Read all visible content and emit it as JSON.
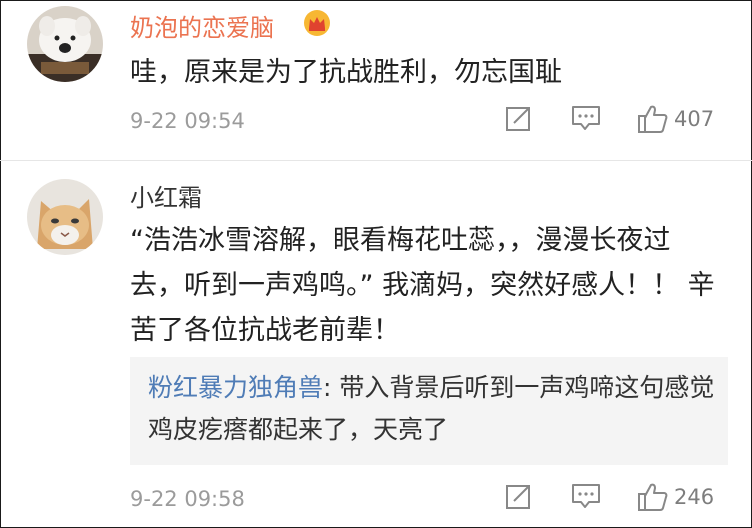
{
  "comments": [
    {
      "username": "奶泡的恋爱脑",
      "badge_icon": "crown-icon",
      "text": "哇，原来是为了抗战胜利，勿忘国耻",
      "time": "9-22 09:54",
      "likes": "407"
    },
    {
      "username": "小红霜",
      "text": "“浩浩冰雪溶解，眼看梅花吐蕊，，漫漫长夜过去，听到一声鸡鸣。” 我滴妈，突然好感人！！ 辛苦了各位抗战老前辈！",
      "reply": {
        "username": "粉红暴力独角兽",
        "text": ": 带入背景后听到一声鸡啼这句感觉鸡皮疙瘩都起来了，天亮了"
      },
      "time": "9-22 09:58",
      "likes": "246"
    }
  ],
  "colors": {
    "username_highlight": "#eb7350",
    "reply_name": "#4f7cb6",
    "meta": "#9b9b9b",
    "quote_bg": "#f4f4f4"
  }
}
